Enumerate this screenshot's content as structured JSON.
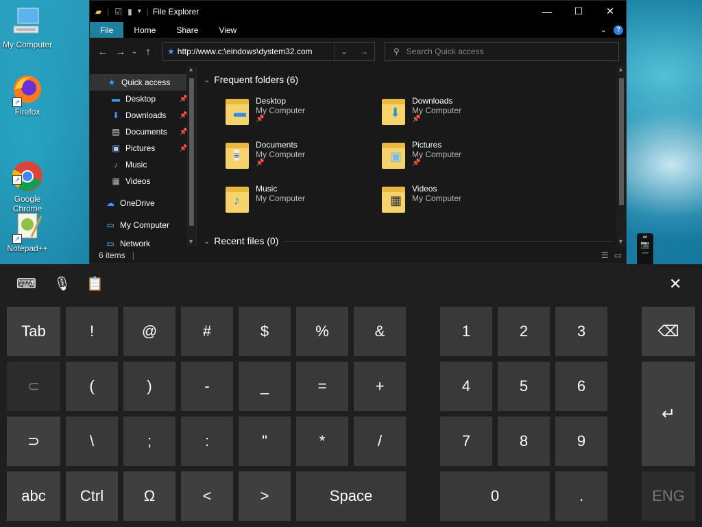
{
  "desktop": {
    "icons": [
      {
        "label": "My Computer"
      },
      {
        "label": "Firefox"
      },
      {
        "label": "Google\nChrome"
      },
      {
        "label": "Notepad++"
      }
    ]
  },
  "explorer": {
    "title": "File Explorer",
    "ribbon": {
      "tabs": [
        "File",
        "Home",
        "Share",
        "View"
      ]
    },
    "address": {
      "value": "http://www.c:\\eindows\\dystem32.com"
    },
    "search": {
      "placeholder": "Search Quick access"
    },
    "nav": {
      "items": [
        {
          "label": "Quick access",
          "icon": "star-icon"
        },
        {
          "label": "Desktop",
          "icon": "desktop-icon",
          "pinned": true
        },
        {
          "label": "Downloads",
          "icon": "download-arrow-icon",
          "pinned": true
        },
        {
          "label": "Documents",
          "icon": "document-icon",
          "pinned": true
        },
        {
          "label": "Pictures",
          "icon": "picture-icon",
          "pinned": true
        },
        {
          "label": "Music",
          "icon": "music-note-icon"
        },
        {
          "label": "Videos",
          "icon": "video-icon"
        },
        {
          "label": "OneDrive",
          "icon": "cloud-icon"
        },
        {
          "label": "My Computer",
          "icon": "computer-icon"
        },
        {
          "label": "Network",
          "icon": "network-icon"
        }
      ]
    },
    "frequent": {
      "header": "Frequent folders (6)",
      "folders": [
        {
          "name": "Desktop",
          "location": "My Computer",
          "pinned": true
        },
        {
          "name": "Downloads",
          "location": "My Computer",
          "pinned": true
        },
        {
          "name": "Documents",
          "location": "My Computer",
          "pinned": true
        },
        {
          "name": "Pictures",
          "location": "My Computer",
          "pinned": true
        },
        {
          "name": "Music",
          "location": "My Computer",
          "pinned": false
        },
        {
          "name": "Videos",
          "location": "My Computer",
          "pinned": false
        }
      ]
    },
    "recent": {
      "header": "Recent files (0)"
    },
    "status": {
      "items": "6 items"
    }
  },
  "keyboard": {
    "rows": [
      [
        "Tab",
        "!",
        "@",
        "#",
        "$",
        "%",
        "&"
      ],
      [
        "",
        "(",
        ")",
        "-",
        "_",
        "=",
        "+"
      ],
      [
        "",
        "\\",
        ";",
        ":",
        "\"",
        "*",
        "/"
      ],
      [
        "abc",
        "Ctrl",
        "Ω",
        "<",
        ">",
        "Space"
      ]
    ],
    "numpad": [
      "1",
      "2",
      "3",
      "4",
      "5",
      "6",
      "7",
      "8",
      "9",
      "0",
      "."
    ],
    "lang": "ENG"
  },
  "colors": {
    "accent": "#1f7f9c",
    "window": "#191919",
    "key": "#393939"
  }
}
